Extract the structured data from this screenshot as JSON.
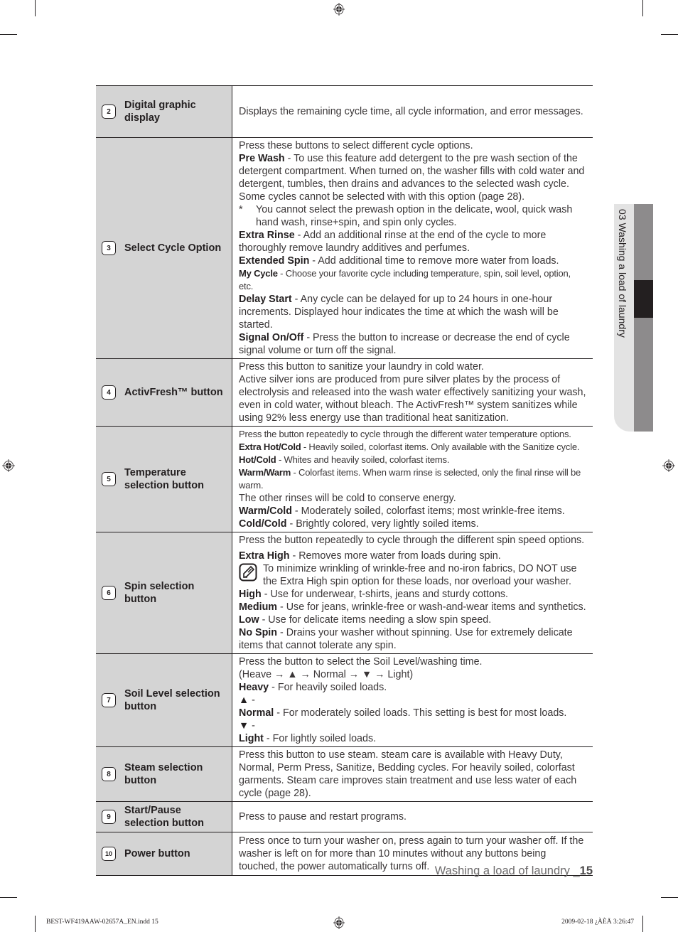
{
  "side_tab": {
    "label": "03 Washing a load of laundry"
  },
  "rows": [
    {
      "number": "2",
      "label": "Digital graphic display",
      "lines": [
        {
          "text": "Displays the remaining cycle time, all cycle information, and error messages."
        }
      ]
    },
    {
      "number": "3",
      "label": "Select Cycle Option",
      "intro": "Press these buttons to select different cycle options.",
      "items": [
        {
          "term": "Pre Wash",
          "text": " - To use this feature add detergent to the pre wash section of the detergent compartment. When turned on, the washer fills with cold water and detergent, tumbles, then drains and advances to the selected wash cycle. Some cycles cannot be selected with with this option (page 28)."
        }
      ],
      "bullet": {
        "mark": "*",
        "text": "You cannot select the prewash option in the delicate, wool, quick wash hand wash, rinse+spin, and spin only cycles."
      },
      "items2": [
        {
          "term": "Extra Rinse",
          "text": " - Add an additional rinse at the end of the cycle to more thoroughly remove laundry additives and perfumes."
        },
        {
          "term": "Extended Spin",
          "text": " - Add additional time to remove more water from loads."
        },
        {
          "term": "My Cycle",
          "text": " - Choose your favorite cycle including temperature, spin, soil level, option, etc."
        },
        {
          "term": "Delay Start",
          "text": " - Any cycle can be delayed for up to 24 hours in one-hour increments. Displayed hour indicates the time at which the wash will be started."
        },
        {
          "term": "Signal On/Off",
          "text": " - Press the button to increase or decrease the end of cycle signal volume or turn off the signal."
        }
      ]
    },
    {
      "number": "4",
      "label": "ActivFresh™ button",
      "intro": "Press this button to sanitize your laundry in cold water.",
      "body": "Active silver ions are produced from pure silver plates by the process of electrolysis and released into the wash water effectively sanitizing your wash, even in cold water, without bleach. The ActivFresh™ system sanitizes while using 92% less energy use than traditional heat sanitization."
    },
    {
      "number": "5",
      "label": "Temperature selection button",
      "intro": "Press the button repeatedly to cycle through the different water temperature options.",
      "items": [
        {
          "term": "Extra Hot/Cold",
          "text": " - Heavily soiled, colorfast items. Only available with the Sanitize cycle."
        },
        {
          "term": "Hot/Cold",
          "text": " - Whites and heavily soiled, colorfast items."
        },
        {
          "term": "Warm/Warm",
          "text": " - Colorfast items. When warm rinse is selected, only the final rinse will be warm."
        }
      ],
      "extra": "The other rinses will be cold to conserve energy.",
      "items2": [
        {
          "term": "Warm/Cold",
          "text": " - Moderately soiled, colorfast items; most wrinkle-free items."
        },
        {
          "term": "Cold/Cold",
          "text": " - Brightly colored, very lightly soiled items."
        }
      ]
    },
    {
      "number": "6",
      "label": "Spin selection button",
      "intro": "Press the button repeatedly to cycle through the different spin speed options.",
      "items": [
        {
          "term": "Extra High",
          "text": " - Removes more water from loads during spin."
        }
      ],
      "note": "To minimize wrinkling of wrinkle-free and no-iron fabrics, DO NOT use the Extra High spin option for these loads, nor overload your washer.",
      "items2": [
        {
          "term": "High",
          "text": " - Use for underwear, t-shirts, jeans and sturdy cottons."
        },
        {
          "term": "Medium",
          "text": " - Use for jeans, wrinkle-free or wash-and-wear items and synthetics."
        },
        {
          "term": "Low",
          "text": " - Use for delicate items needing a slow spin speed."
        },
        {
          "term": "No Spin",
          "text": " - Drains your washer without spinning. Use for extremely delicate items that cannot tolerate any spin."
        }
      ]
    },
    {
      "number": "7",
      "label": "Soil Level selection button",
      "intro": "Press the button to select the Soil Level/washing time.",
      "sequence": "(Heave → ▲ → Normal → ▼ → Light)",
      "items": [
        {
          "term": "Heavy",
          "text": " - For heavily soiled loads."
        },
        {
          "term": "▲",
          "text": " -"
        },
        {
          "term": "Normal",
          "text": " - For moderately soiled loads. This setting is best for most loads."
        },
        {
          "term": "▼",
          "text": " -"
        },
        {
          "term": "Light",
          "text": " - For lightly soiled loads."
        }
      ]
    },
    {
      "number": "8",
      "label": "Steam selection button",
      "body": "Press this button to use steam. steam care is available with Heavy Duty, Normal, Perm Press, Sanitize, Bedding cycles. For heavily soiled, colorfast garments. Steam care improves stain treatment and use less water of each cycle (page 28)."
    },
    {
      "number": "9",
      "label": "Start/Pause selection button",
      "body": "Press to pause and restart programs."
    },
    {
      "number": "10",
      "label": "Power button",
      "body": "Press once to turn your washer on, press again to turn your washer off. If the washer is left on for more than 10 minutes without any buttons being touched, the power automatically turns off."
    }
  ],
  "footer": {
    "title": "Washing a load of laundry _",
    "page": "15"
  },
  "slug": {
    "file": "BEST-WF419AAW-02657A_EN.indd   15",
    "date": "2009-02-18   ¿ÀÈÄ 3:26:47"
  }
}
